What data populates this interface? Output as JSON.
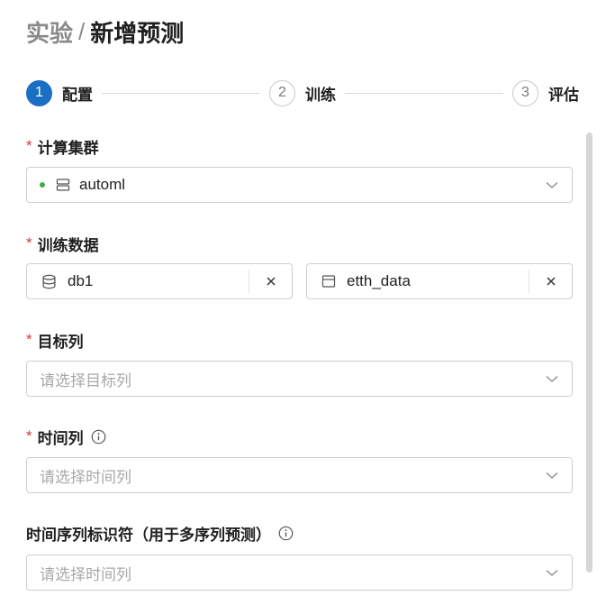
{
  "breadcrumb": {
    "parent": "实验",
    "separator": "/",
    "current": "新增预测"
  },
  "steps": [
    {
      "number": "1",
      "label": "配置",
      "active": true
    },
    {
      "number": "2",
      "label": "训练",
      "active": false
    },
    {
      "number": "3",
      "label": "评估",
      "active": false
    }
  ],
  "form": {
    "cluster": {
      "required_mark": "*",
      "label": "计算集群",
      "value": "automl",
      "status_color": "#3dae48"
    },
    "training_data": {
      "required_mark": "*",
      "label": "训练数据",
      "database": "db1",
      "table": "etth_data"
    },
    "target_column": {
      "required_mark": "*",
      "label": "目标列",
      "placeholder": "请选择目标列"
    },
    "time_column": {
      "required_mark": "*",
      "label": "时间列",
      "placeholder": "请选择时间列"
    },
    "series_id": {
      "label": "时间序列标识符（用于多序列预测）",
      "placeholder": "请选择时间列"
    }
  },
  "colors": {
    "primary": "#1a6fc4",
    "required": "#d9363e"
  }
}
